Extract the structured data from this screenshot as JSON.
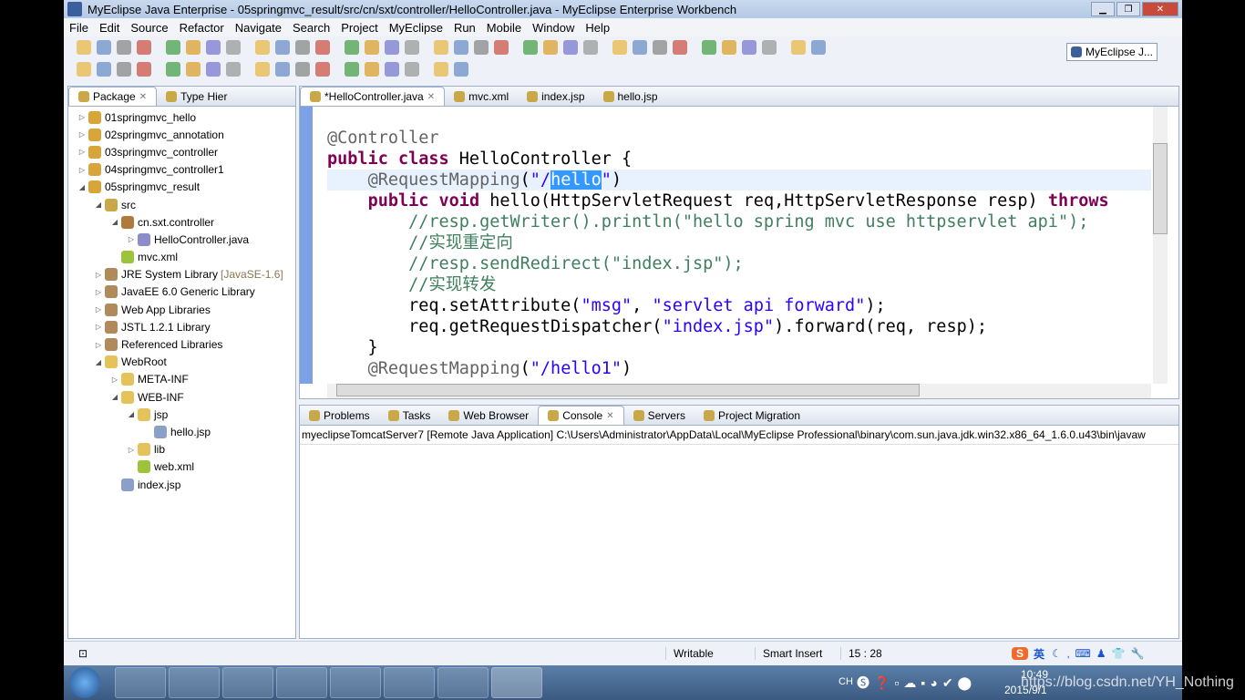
{
  "window": {
    "title": "MyEclipse Java Enterprise - 05springmvc_result/src/cn/sxt/controller/HelloController.java - MyEclipse Enterprise Workbench"
  },
  "menu": [
    "File",
    "Edit",
    "Source",
    "Refactor",
    "Navigate",
    "Search",
    "Project",
    "MyEclipse",
    "Run",
    "Mobile",
    "Window",
    "Help"
  ],
  "perspective": "MyEclipse J...",
  "explorer": {
    "tabs": [
      "Package",
      "Type Hier"
    ],
    "items": [
      {
        "label": "01springmvc_hello",
        "level": 0,
        "tw": "▷",
        "icon": "project"
      },
      {
        "label": "02springmvc_annotation",
        "level": 0,
        "tw": "▷",
        "icon": "project"
      },
      {
        "label": "03springmvc_controller",
        "level": 0,
        "tw": "▷",
        "icon": "project"
      },
      {
        "label": "04springmvc_controller1",
        "level": 0,
        "tw": "▷",
        "icon": "project"
      },
      {
        "label": "05springmvc_result",
        "level": 0,
        "tw": "◢",
        "icon": "project"
      },
      {
        "label": "src",
        "level": 1,
        "tw": "◢",
        "icon": "src"
      },
      {
        "label": "cn.sxt.controller",
        "level": 2,
        "tw": "◢",
        "icon": "package"
      },
      {
        "label": "HelloController.java",
        "level": 3,
        "tw": "▷",
        "icon": "java"
      },
      {
        "label": "mvc.xml",
        "level": 2,
        "tw": "",
        "icon": "xml"
      },
      {
        "label": "JRE System Library",
        "deco": "[JavaSE-1.6]",
        "level": 1,
        "tw": "▷",
        "icon": "library"
      },
      {
        "label": "JavaEE 6.0 Generic Library",
        "level": 1,
        "tw": "▷",
        "icon": "library"
      },
      {
        "label": "Web App Libraries",
        "level": 1,
        "tw": "▷",
        "icon": "library"
      },
      {
        "label": "JSTL 1.2.1 Library",
        "level": 1,
        "tw": "▷",
        "icon": "library"
      },
      {
        "label": "Referenced Libraries",
        "level": 1,
        "tw": "▷",
        "icon": "library"
      },
      {
        "label": "WebRoot",
        "level": 1,
        "tw": "◢",
        "icon": "folder"
      },
      {
        "label": "META-INF",
        "level": 2,
        "tw": "▷",
        "icon": "folder"
      },
      {
        "label": "WEB-INF",
        "level": 2,
        "tw": "◢",
        "icon": "folder"
      },
      {
        "label": "jsp",
        "level": 3,
        "tw": "◢",
        "icon": "folder"
      },
      {
        "label": "hello.jsp",
        "level": 4,
        "tw": "",
        "icon": "jsp"
      },
      {
        "label": "lib",
        "level": 3,
        "tw": "▷",
        "icon": "folder"
      },
      {
        "label": "web.xml",
        "level": 3,
        "tw": "",
        "icon": "xml"
      },
      {
        "label": "index.jsp",
        "level": 2,
        "tw": "",
        "icon": "jsp"
      }
    ]
  },
  "editor": {
    "tabs": [
      "*HelloController.java",
      "mvc.xml",
      "index.jsp",
      "hello.jsp"
    ],
    "lines": [
      [],
      [
        [
          "an",
          "@Controller"
        ]
      ],
      [
        [
          "kw",
          "public class "
        ],
        [
          "",
          "HelloController {"
        ]
      ],
      [
        [
          "",
          "    "
        ],
        [
          "an",
          "@RequestMapping"
        ],
        [
          "",
          "("
        ],
        [
          "st",
          "\"/"
        ],
        [
          "sel",
          "hello"
        ],
        [
          "st",
          "\""
        ],
        [
          "",
          ")"
        ]
      ],
      [
        [
          "",
          "    "
        ],
        [
          "kw",
          "public void "
        ],
        [
          "",
          "hello(HttpServletRequest req,HttpServletResponse resp) "
        ],
        [
          "kw",
          "throws"
        ]
      ],
      [
        [
          "",
          "        "
        ],
        [
          "cm",
          "//resp.getWriter().println(\"hello spring mvc use httpservlet api\");"
        ]
      ],
      [
        [
          "",
          "        "
        ],
        [
          "cm",
          "//实现重定向"
        ]
      ],
      [
        [
          "",
          "        "
        ],
        [
          "cm",
          "//resp.sendRedirect(\"index.jsp\");"
        ]
      ],
      [
        [
          "",
          "        "
        ],
        [
          "cm",
          "//实现转发"
        ]
      ],
      [
        [
          "",
          "        req.setAttribute("
        ],
        [
          "st",
          "\"msg\""
        ],
        [
          "",
          ", "
        ],
        [
          "st",
          "\"servlet api forward\""
        ],
        [
          "",
          ");"
        ]
      ],
      [
        [
          "",
          "        req.getRequestDispatcher("
        ],
        [
          "st",
          "\"index.jsp\""
        ],
        [
          "",
          ").forward(req, resp);"
        ]
      ],
      [
        [
          "",
          "    }"
        ]
      ],
      [
        [
          "",
          "    "
        ],
        [
          "an",
          "@RequestMapping"
        ],
        [
          "",
          "("
        ],
        [
          "st",
          "\"/hello1\""
        ],
        [
          "",
          ")"
        ]
      ]
    ]
  },
  "console": {
    "tabs": [
      "Problems",
      "Tasks",
      "Web Browser",
      "Console",
      "Servers",
      "Project Migration"
    ],
    "header": "myeclipseTomcatServer7 [Remote Java Application] C:\\Users\\Administrator\\AppData\\Local\\MyEclipse Professional\\binary\\com.sun.java.jdk.win32.x86_64_1.6.0.u43\\bin\\javaw"
  },
  "status": {
    "mode": "Writable",
    "insert": "Smart Insert",
    "position": "15 : 28"
  },
  "ime": "英",
  "tray": {
    "lang": "CH",
    "time": "10:49",
    "date": "2015/9/1"
  },
  "watermark": "https://blog.csdn.net/YH_Nothing"
}
